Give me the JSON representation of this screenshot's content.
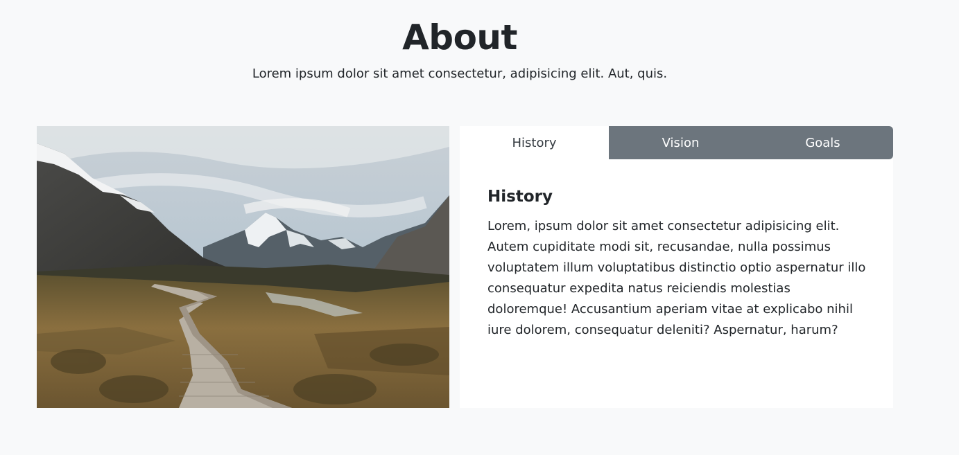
{
  "about": {
    "title": "About",
    "subtitle": "Lorem ipsum dolor sit amet consectetur, adipisicing elit. Aut, quis."
  },
  "tabs": [
    {
      "label": "History",
      "active": true
    },
    {
      "label": "Vision",
      "active": false
    },
    {
      "label": "Goals",
      "active": false
    }
  ],
  "panel": {
    "title": "History",
    "body": "Lorem, ipsum dolor sit amet consectetur adipisicing elit. Autem cupiditate modi sit, recusandae, nulla possimus voluptatem illum voluptatibus distinctio optio aspernatur illo consequatur expedita natus reiciendis molestias doloremque! Accusantium aperiam vitae at explicabo nihil iure dolorem, consequatur deleniti? Aspernatur, harum?"
  },
  "colors": {
    "page_bg": "#f8f9fa",
    "tab_bar": "#6c757d",
    "panel_bg": "#ffffff",
    "text": "#212529"
  }
}
